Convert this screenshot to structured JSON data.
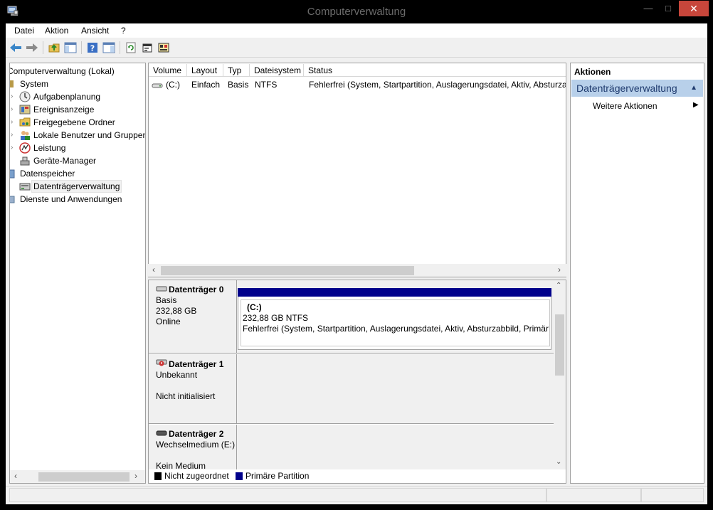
{
  "window": {
    "title": "Computerverwaltung"
  },
  "menu": [
    "Datei",
    "Aktion",
    "Ansicht",
    "?"
  ],
  "tree": {
    "root": "Computerverwaltung (Lokal)",
    "system": "System",
    "aufgaben": "Aufgabenplanung",
    "ereignis": "Ereignisanzeige",
    "freigegeben": "Freigegebene Ordner",
    "benutzer": "Lokale Benutzer und Gruppen",
    "leistung": "Leistung",
    "geraete": "Geräte-Manager",
    "datenspeicher": "Datenspeicher",
    "datentraeger": "Datenträgerverwaltung",
    "dienste": "Dienste und Anwendungen"
  },
  "volumes": {
    "columns": [
      "Volume",
      "Layout",
      "Typ",
      "Dateisystem",
      "Status"
    ],
    "rows": [
      {
        "volume": "(C:)",
        "layout": "Einfach",
        "typ": "Basis",
        "dateisystem": "NTFS",
        "status": "Fehlerfrei (System, Startpartition, Auslagerungsdatei, Aktiv, Absturzab"
      }
    ]
  },
  "disks": [
    {
      "name": "Datenträger 0",
      "type": "Basis",
      "size": "232,88 GB",
      "state": "Online",
      "partition": {
        "label": "(C:)",
        "size": "232,88 GB NTFS",
        "status": "Fehlerfrei (System, Startpartition, Auslagerungsdatei, Aktiv, Absturzabbild, Primär"
      }
    },
    {
      "name": "Datenträger 1",
      "type": "Unbekannt",
      "state": "Nicht initialisiert"
    },
    {
      "name": "Datenträger 2",
      "type": "Wechselmedium (E:)",
      "state": "Kein Medium"
    }
  ],
  "legend": [
    {
      "label": "Nicht zugeordnet",
      "color": "#000000"
    },
    {
      "label": "Primäre Partition",
      "color": "#00008b"
    }
  ],
  "actions": {
    "title": "Aktionen",
    "section": "Datenträgerverwaltung",
    "more": "Weitere Aktionen"
  }
}
